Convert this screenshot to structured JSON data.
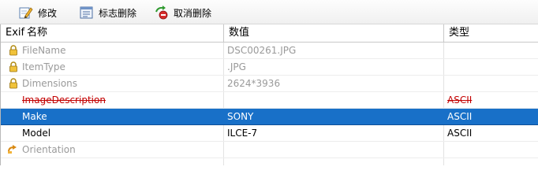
{
  "toolbar": {
    "modify_label": "修改",
    "mark_delete_label": "标志删除",
    "cancel_delete_label": "取消删除"
  },
  "table": {
    "headers": {
      "exif": "Exif",
      "name": "名称",
      "value": "数值",
      "type": "类型"
    },
    "rows": [
      {
        "name": "FileName",
        "value": "DSC00261.JPG",
        "type": ""
      },
      {
        "name": "ItemType",
        "value": ".JPG",
        "type": ""
      },
      {
        "name": "Dimensions",
        "value": "2624*3936",
        "type": ""
      },
      {
        "name": "ImageDescription",
        "value": "",
        "type": "ASCII"
      },
      {
        "name": "Make",
        "value": "SONY",
        "type": "ASCII"
      },
      {
        "name": "Model",
        "value": "ILCE-7",
        "type": "ASCII"
      },
      {
        "name": "Orientation",
        "value": "",
        "type": ""
      }
    ]
  },
  "colors": {
    "selection": "#1870c8",
    "deleted_text": "#c30000",
    "readonly_text": "#9a9a9a"
  }
}
